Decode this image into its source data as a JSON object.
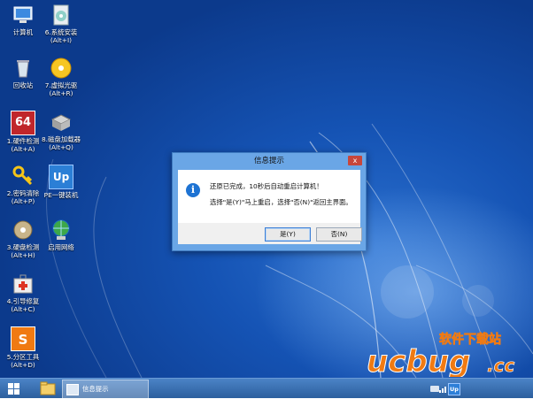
{
  "desktop_icons": [
    {
      "name": "计算机"
    },
    {
      "name": "6.系统安装",
      "hotkey": "(Alt+I)"
    },
    {
      "name": "回收站"
    },
    {
      "name": "7.虚拟光驱",
      "hotkey": "(Alt+R)"
    },
    {
      "name": "1.硬件检测",
      "hotkey": "(Alt+A)",
      "badge": "64"
    },
    {
      "name": "8.磁盘加载器",
      "hotkey": "(Alt+Q)"
    },
    {
      "name": "2.密码清除",
      "hotkey": "(Alt+P)"
    },
    {
      "name": "PE一键装机",
      "badge": "Up"
    },
    {
      "name": "3.硬盘检测",
      "hotkey": "(Alt+H)"
    },
    {
      "name": "启用网络"
    },
    {
      "name": "4.引导修复",
      "hotkey": "(Alt+C)"
    },
    {
      "name": "5.分区工具",
      "hotkey": "(Alt+D)"
    }
  ],
  "dialog": {
    "title": "信息提示",
    "close_glyph": "x",
    "message_line1": "还原已完成，10秒后自动重启计算机！",
    "message_line2": "选择\"是(Y)\"马上重启，选择\"否(N)\"返回主界面。",
    "yes_label": "是(Y)",
    "no_label": "否(N)",
    "info_glyph": "i"
  },
  "taskbar": {
    "task_label": "信息提示",
    "tray_up_label": "Up"
  },
  "watermark": {
    "top_text": "软件下载站",
    "logo_text": "ucbug",
    "domain_text": ".cc"
  },
  "colors": {
    "dialog_frame": "#6aa6e6",
    "close_button": "#c7463b",
    "watermark_orange": "#f07a12"
  }
}
